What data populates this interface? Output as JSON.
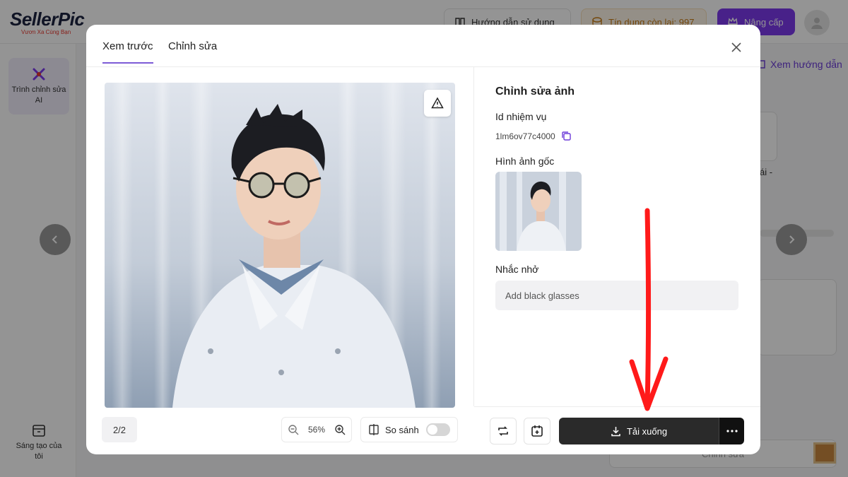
{
  "app": {
    "logo_brand": "SellerPic",
    "logo_tagline": "Vươn Xa Cùng Bạn",
    "guide_label": "Hướng dẫn sử dụng",
    "credits_label": "Tín dụng còn lại: 997",
    "upgrade_label": "Nâng cấp",
    "sidebar": [
      {
        "label": "Trình chỉnh sửa AI",
        "icon": "magic-tools-icon"
      },
      {
        "label": "Sáng tạo của tôi",
        "icon": "archive-box-icon"
      }
    ],
    "view_guide_link": "Xem hướng dẫn",
    "bg_fragment_text": "ái -",
    "bg_bottom_button": "Chỉnh sửa"
  },
  "modal": {
    "tabs": [
      {
        "label": "Xem trước",
        "active": true
      },
      {
        "label": "Chỉnh sửa",
        "active": false
      }
    ],
    "page_indicator": "2/2",
    "zoom_level": "56%",
    "compare_label": "So sánh",
    "compare_enabled": false,
    "edit_title": "Chỉnh sửa ảnh",
    "task_id_label": "Id nhiệm vụ",
    "task_id_value": "1lm6ov77c4000",
    "original_image_label": "Hình ảnh gốc",
    "reminder_label": "Nhắc nhở",
    "reminder_value": "Add black glasses",
    "download_label": "Tải xuống"
  },
  "colors": {
    "accent": "#7c5bd6",
    "download_bg": "#2a2a2a",
    "annotation_arrow": "#ff1a1a"
  }
}
